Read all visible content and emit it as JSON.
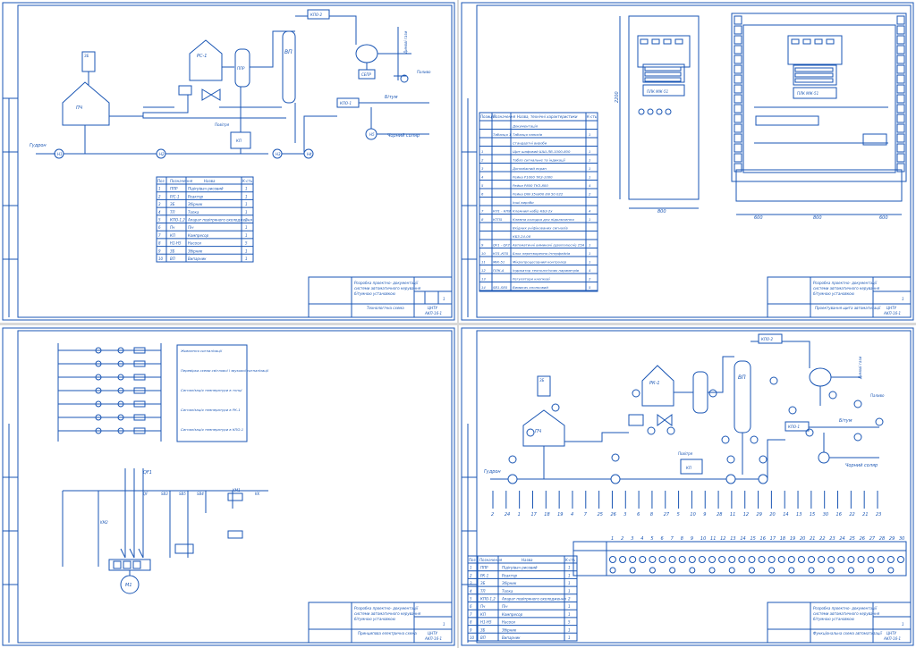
{
  "colors": {
    "ink": "#1a56b4",
    "paper": "#ffffff",
    "gap": "#d9d9d9"
  },
  "sheet1": {
    "table_header": [
      "Поз",
      "Позначення",
      "Назва",
      "К-сть"
    ],
    "table_rows": [
      [
        "1",
        "ППР",
        "Підігрівач рисовий",
        "1"
      ],
      [
        "2",
        "Р/С-1",
        "Реактор",
        "1"
      ],
      [
        "3",
        "ЗБ",
        "Збірник",
        "1"
      ],
      [
        "4",
        "ТП",
        "Топка",
        "1"
      ],
      [
        "5",
        "КПО-1,2",
        "Апарат повітряного охолодження",
        "2"
      ],
      [
        "6",
        "Пч",
        "Піч",
        "1"
      ],
      [
        "7",
        "КП",
        "Компресор",
        "1"
      ],
      [
        "8",
        "Н1-Н5",
        "Насоси",
        "5"
      ],
      [
        "9",
        "ЗБ",
        "Збірник",
        "1"
      ],
      [
        "10",
        "ВП",
        "Випарник",
        "1"
      ]
    ],
    "labels": {
      "input": "Гудрон",
      "bitumen": "Бітум",
      "out_gas": "Димові гази",
      "fuel": "Паливо",
      "black_oil": "Чорний соляр",
      "air": "Повітря",
      "vp": "ВП",
      "kpo2": "КПО-2",
      "kpo1": "КПО-1",
      "sepr": "СЕПР",
      "rs1": "РС-1",
      "pch": "ПЧ",
      "zb": "ЗБ",
      "kp": "КП",
      "ppr": "ППР",
      "n1": "Н1",
      "n2": "Н2",
      "n3": "Н3",
      "n4": "Н4",
      "n5": "Н5"
    },
    "stamp": {
      "title_line1": "Розробка проектно- документації",
      "title_line2": "системи автоматичного керування",
      "title_line3": "бітумною установкою",
      "sheet_title": "Технологічна схема",
      "org": "ЦНТУ",
      "group": "АКП-16-1",
      "sheet_no": "1"
    }
  },
  "sheet2": {
    "table_header": [
      "Позиція",
      "Позначення",
      "Назва, технічні характеристики",
      "К-сть"
    ],
    "table_rows": [
      [
        "",
        "",
        "Документація",
        ""
      ],
      [
        "",
        "Таблиця 1",
        "Таблиця написів",
        "1"
      ],
      [
        "",
        "",
        "Стандартні вироби",
        ""
      ],
      [
        "1",
        "",
        "Щит шафовий ШШ-ЛВ-1000-800",
        "1"
      ],
      [
        "2",
        "",
        "Табло сигнальне та індикації",
        "1"
      ],
      [
        "3",
        "",
        "Допоміжний екран",
        "1"
      ],
      [
        "4",
        "",
        "Рейка Р1000 ТКЗ-1000",
        "1"
      ],
      [
        "5",
        "",
        "Рейка Р800 ТКЗ-800",
        "4"
      ],
      [
        "6",
        "",
        "Рейка DIN 35х800 EN 50 022",
        "2"
      ],
      [
        "",
        "",
        "Інші вироби",
        ""
      ],
      [
        "7",
        "КП1 - КП8",
        "Клемний набір КБЗ-2х",
        "4"
      ],
      [
        "8",
        "КТП5",
        "Клемна колодка для підключення",
        "1"
      ],
      [
        "",
        "",
        "Вхідних уніфікованих сигналів",
        ""
      ],
      [
        "",
        "",
        "КБЗ-24-08",
        ""
      ],
      [
        "9",
        "QF1 - QF2",
        "Автоматичні вимикачі (двополюсні) 25A",
        "1"
      ],
      [
        "10",
        "КП1-КП5",
        "Блок перетворення інтерфейсів",
        "1"
      ],
      [
        "11",
        "МІК-51",
        "Мікропроцесорний контролер",
        "1"
      ],
      [
        "12",
        "ПЛК-А",
        "Індикатор технологічних параметрів",
        "4"
      ],
      [
        "13",
        "",
        "Регулятори кнопкові",
        "2"
      ],
      [
        "14",
        "SB1-SB5",
        "Вимикач кнопковий",
        "5"
      ]
    ],
    "labels": {
      "plc1": "ПЛК МІК-51",
      "plc2": "ПЛК МІК-51",
      "dim_height": "2200",
      "dim_w1": "800",
      "dim_w2": "600",
      "dim_w3": "800",
      "dim_w4": "600"
    },
    "stamp": {
      "title_line1": "Розробка проектно- документації",
      "title_line2": "системи автоматичного керування",
      "title_line3": "бітумною установкою",
      "sheet_title": "Проектування щита автоматизації",
      "org": "ЦНТУ",
      "group": "АКП-16-1",
      "sheet_no": "1"
    }
  },
  "sheet3": {
    "legend": [
      "Живлення сигналізації",
      "Перевірка схеми світлової і звукової сигналізації",
      "Сигналізація температури в топці",
      "Сигналізація температури в РК-1",
      "Сигналізація температури в КПО-1"
    ],
    "labels": {
      "qf1": "QF1",
      "qf": "QF",
      "sb3": "SB3",
      "sb5": "SB5",
      "sb4": "SB4",
      "km1": "KM1",
      "kk": "KK",
      "km2": "KM2",
      "motor": "M1"
    },
    "stamp": {
      "title_line1": "Розробка проектно- документації",
      "title_line2": "системи автоматичного керування",
      "title_line3": "бітумною установкою",
      "sheet_title": "Принципова електрична схема",
      "org": "ЦНТУ",
      "group": "АКП-16-1",
      "sheet_no": "1"
    }
  },
  "sheet4": {
    "bottom_numbers": [
      "2",
      "24",
      "1",
      "17",
      "18",
      "19",
      "4",
      "7",
      "25",
      "26",
      "3",
      "6",
      "8",
      "27",
      "5",
      "10",
      "9",
      "28",
      "11",
      "12",
      "29",
      "20",
      "14",
      "13",
      "15",
      "30",
      "16",
      "22",
      "21",
      "23"
    ],
    "top_numbers": [
      "1",
      "2",
      "3",
      "4",
      "5",
      "6",
      "7",
      "8",
      "9",
      "10",
      "11",
      "12",
      "13",
      "14",
      "15",
      "16",
      "17",
      "18",
      "19",
      "20",
      "21",
      "22",
      "23",
      "24",
      "25",
      "26",
      "27",
      "28",
      "29",
      "30"
    ],
    "table_header": [
      "Поз",
      "Позначення",
      "Назва",
      "К-сть"
    ],
    "table_rows": [
      [
        "1",
        "ППР",
        "Підігрівач рисовий",
        "1"
      ],
      [
        "2",
        "РК-1",
        "Реактор",
        "1"
      ],
      [
        "3",
        "ЗБ",
        "Збірник",
        "1"
      ],
      [
        "4",
        "ТП",
        "Топка",
        "1"
      ],
      [
        "5",
        "КПО-1,2",
        "Апарат повітряного охолодження",
        "2"
      ],
      [
        "6",
        "Пч",
        "Піч",
        "1"
      ],
      [
        "7",
        "КП",
        "Компресор",
        "1"
      ],
      [
        "8",
        "Н1-Н5",
        "Насоси",
        "5"
      ],
      [
        "9",
        "ЗБ",
        "Збірник",
        "1"
      ],
      [
        "10",
        "ВП",
        "Випарник",
        "1"
      ]
    ],
    "labels": {
      "input": "Гудрон",
      "bitumen": "Бітум",
      "out_gas": "Димові гази",
      "fuel": "Паливо",
      "black_oil": "Чорний соляр",
      "air": "Повітря",
      "vp": "ВП",
      "kpo2": "КПО-2",
      "kpo1": "КПО-1",
      "rk1": "РК-1",
      "pch": "ПЧ",
      "zb": "ЗБ",
      "kp": "КП"
    },
    "stamp": {
      "title_line1": "Розробка проектно- документації",
      "title_line2": "системи автоматичного керування",
      "title_line3": "бітумною установкою",
      "sheet_title": "Функціональна схема автоматизації",
      "org": "ЦНТУ",
      "group": "АКП-16-1",
      "sheet_no": "1"
    }
  }
}
